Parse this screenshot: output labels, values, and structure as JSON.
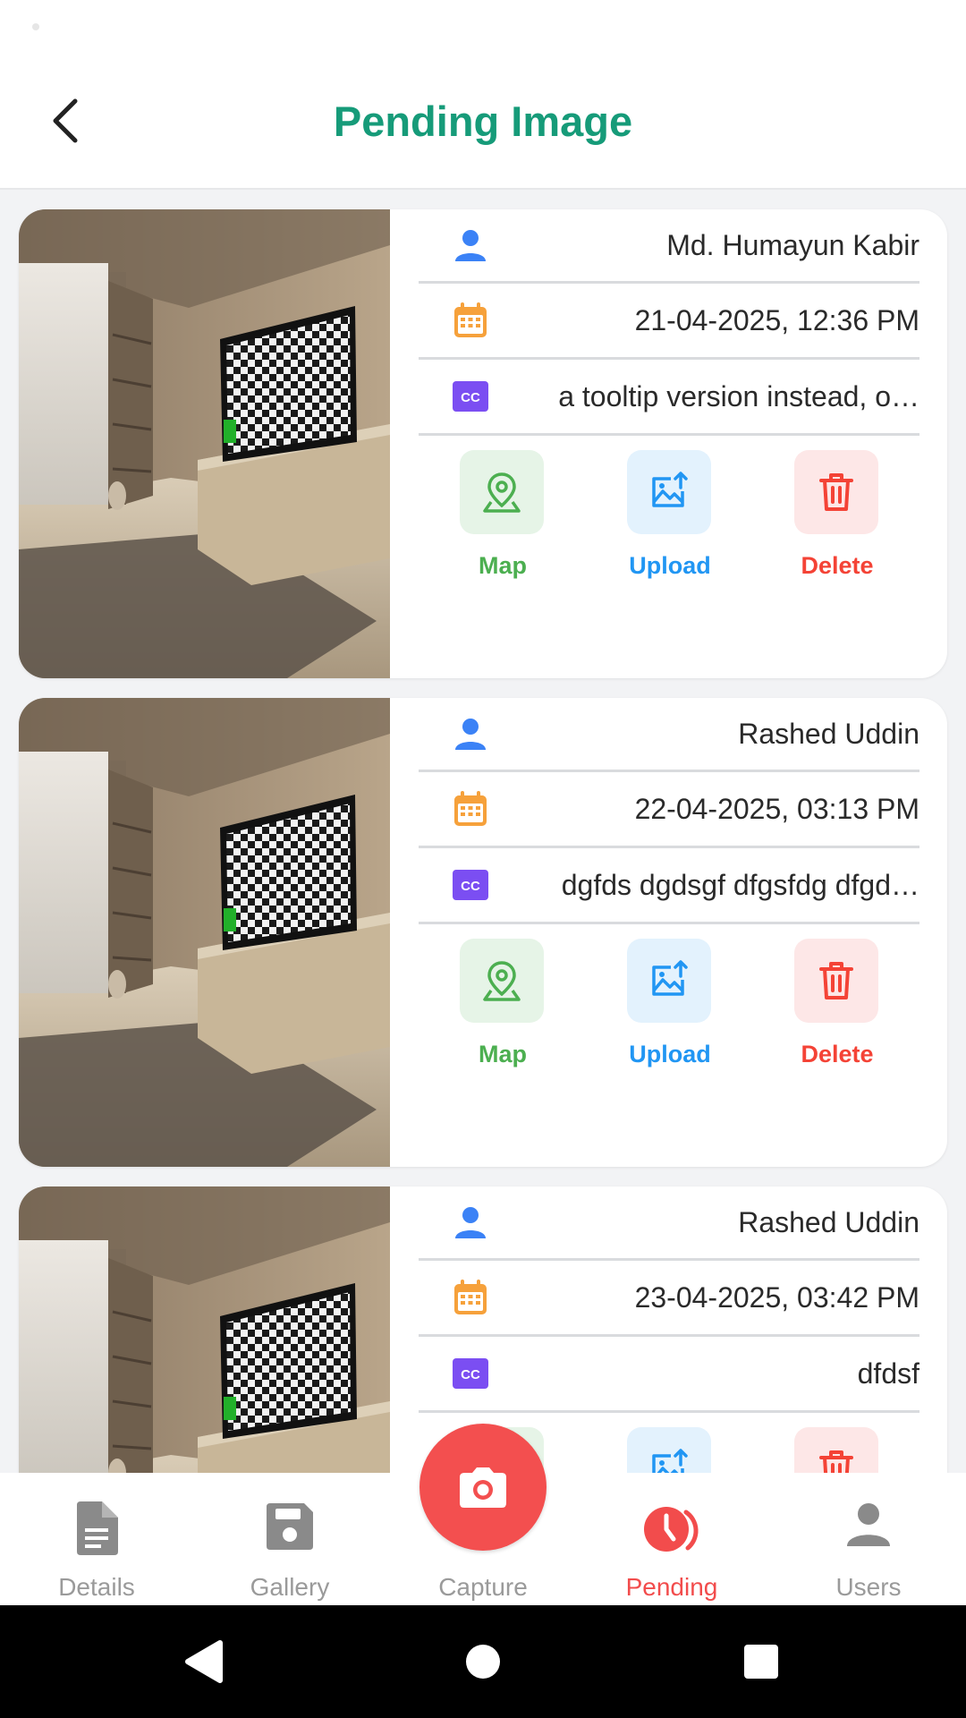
{
  "header": {
    "title": "Pending Image"
  },
  "actions": {
    "map": "Map",
    "upload": "Upload",
    "delete": "Delete"
  },
  "colors": {
    "accent": "#169b79",
    "user_icon": "#3b82f6",
    "date_icon": "#f6a13b",
    "caption_icon": "#7b4ef2",
    "map": "#4caf50",
    "upload": "#2196f3",
    "delete": "#f44336",
    "active_nav": "#f24c4c"
  },
  "records": [
    {
      "user": "Md. Humayun Kabir",
      "datetime": "21-04-2025, 12:36 PM",
      "caption": "a tooltip version instead, o…"
    },
    {
      "user": "Rashed Uddin",
      "datetime": "22-04-2025, 03:13 PM",
      "caption": "dgfds dgdsgf dfgsfdg dfgd…"
    },
    {
      "user": "Rashed Uddin",
      "datetime": "23-04-2025, 03:42 PM",
      "caption": "dfdsf"
    }
  ],
  "nav": {
    "items": [
      {
        "label": "Details",
        "icon": "document-icon"
      },
      {
        "label": "Gallery",
        "icon": "save-icon"
      },
      {
        "label": "Capture",
        "icon": "camera-icon"
      },
      {
        "label": "Pending",
        "icon": "pending-clock-icon",
        "active": true
      },
      {
        "label": "Users",
        "icon": "user-icon"
      }
    ]
  }
}
